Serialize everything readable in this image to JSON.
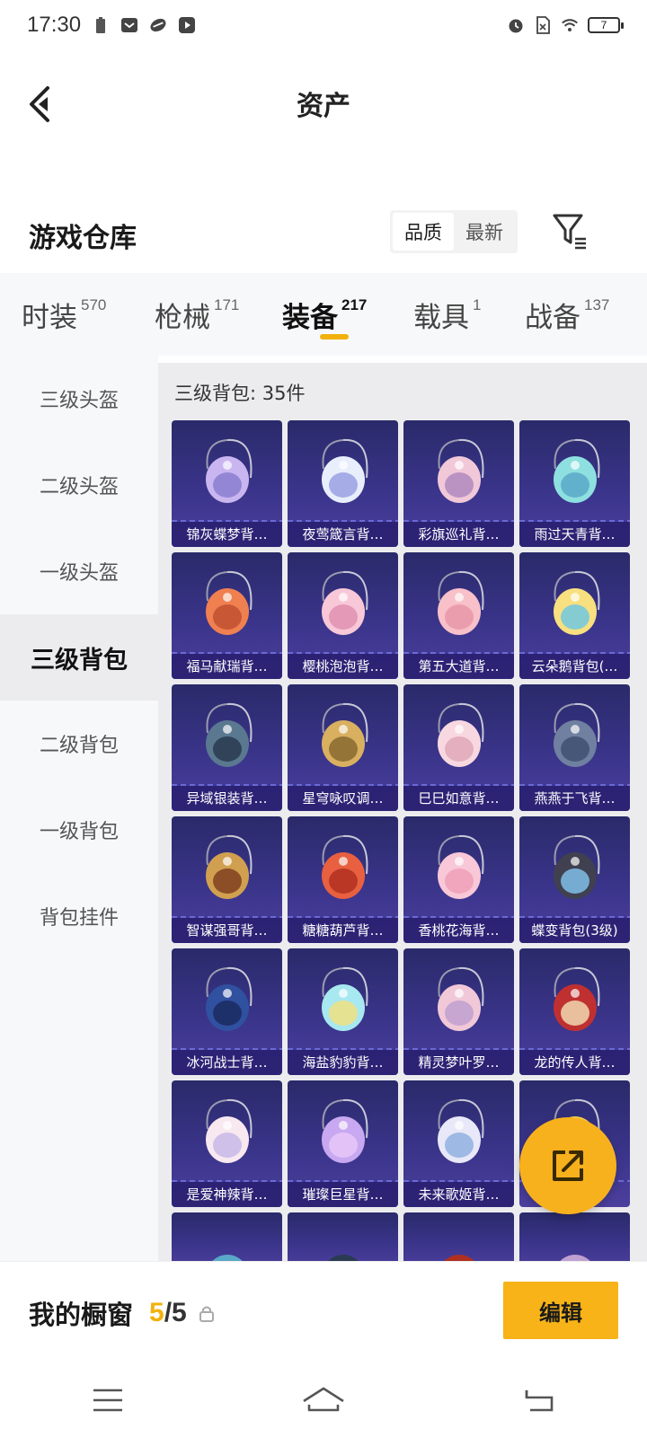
{
  "status_bar": {
    "time": "17:30",
    "battery": "7",
    "left_icons": [
      "battery-saver-icon",
      "mail-icon",
      "game-icon",
      "play-icon"
    ],
    "right_icons": [
      "alarm-icon",
      "sim-icon",
      "wifi-icon"
    ]
  },
  "header": {
    "title": "资产"
  },
  "warehouse": {
    "title": "游戏仓库",
    "sort_options": [
      "品质",
      "最新"
    ],
    "sort_selected": "品质"
  },
  "tabs": [
    {
      "label": "时装",
      "count": "570"
    },
    {
      "label": "枪械",
      "count": "171"
    },
    {
      "label": "装备",
      "count": "217",
      "active": true
    },
    {
      "label": "载具",
      "count": "1"
    },
    {
      "label": "战备",
      "count": "137"
    }
  ],
  "sidebar": {
    "items": [
      "三级头盔",
      "二级头盔",
      "一级头盔",
      "三级背包",
      "二级背包",
      "一级背包",
      "背包挂件"
    ],
    "active_index": 3
  },
  "main": {
    "section_title": "三级背包: 35件",
    "items": [
      "锦灰蝶梦背…",
      "夜莺箴言背…",
      "彩旗巡礼背…",
      "雨过天青背…",
      "福马献瑞背…",
      "樱桃泡泡背…",
      "第五大道背…",
      "云朵鹅背包(…",
      "异域银装背…",
      "星穹咏叹调…",
      "巳巳如意背…",
      "燕燕于飞背…",
      "智谋强哥背…",
      "糖糖葫芦背…",
      "香桃花海背…",
      "蝶变背包(3级)",
      "冰河战士背…",
      "海盐豹豹背…",
      "精灵梦叶罗…",
      "龙的传人背…",
      "是爱神辣背…",
      "璀璨巨星背…",
      "未来歌姬背…",
      ""
    ],
    "partial_row_count": 4
  },
  "showcase": {
    "title": "我的橱窗",
    "current": "5",
    "separator": "/",
    "total": "5",
    "edit_label": "编辑"
  },
  "colors": {
    "accent": "#f2b10c",
    "card_bg": "#3a348a",
    "tab_bg": "#f7f8fa"
  }
}
